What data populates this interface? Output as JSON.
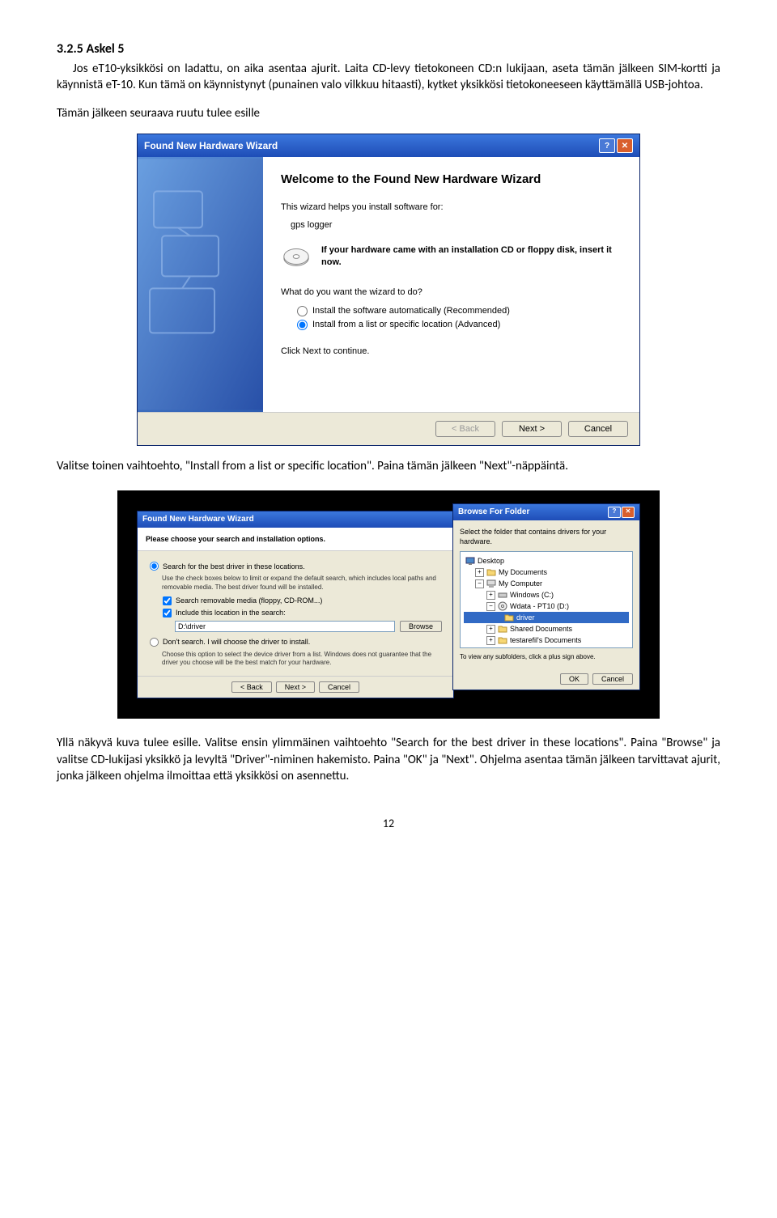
{
  "heading": "3.2.5 Askel 5",
  "para1": "Jos eT10-yksikkösi on ladattu, on aika asentaa ajurit. Laita CD-levy tietokoneen CD:n lukijaan, aseta tämän jälkeen SIM-kortti ja käynnistä eT-10. Kun tämä on käynnistynyt (punainen valo vilkkuu hitaasti), kytket yksikkösi tietokoneeseen käyttämällä USB-johtoa.",
  "para2": "Tämän jälkeen seuraava ruutu tulee esille",
  "wizard1": {
    "title": "Found New Hardware Wizard",
    "welcome": "Welcome to the Found New Hardware Wizard",
    "helps": "This wizard helps you install software for:",
    "device": "gps logger",
    "cd_hint": "If your hardware came with an installation CD or floppy disk, insert it now.",
    "question": "What do you want the wizard to do?",
    "opt1": "Install the software automatically (Recommended)",
    "opt2": "Install from a list or specific location (Advanced)",
    "click_next": "Click Next to continue.",
    "back": "< Back",
    "next": "Next >",
    "cancel": "Cancel"
  },
  "para3": "Valitse toinen vaihtoehto, \"Install from a list or specific location\". Paina tämän jälkeen \"Next\"-näppäintä.",
  "wizard2": {
    "title": "Found New Hardware Wizard",
    "header": "Please choose your search and installation options.",
    "opt_search": "Search for the best driver in these locations.",
    "hint": "Use the check boxes below to limit or expand the default search, which includes local paths and removable media. The best driver found will be installed.",
    "chk1": "Search removable media (floppy, CD-ROM...)",
    "chk2": "Include this location in the search:",
    "path": "D:\\driver",
    "browse": "Browse",
    "opt_dont": "Don't search. I will choose the driver to install.",
    "hint2": "Choose this option to select the device driver from a list. Windows does not guarantee that the driver you choose will be the best match for your hardware.",
    "back": "< Back",
    "next": "Next >",
    "cancel": "Cancel"
  },
  "browse": {
    "title": "Browse For Folder",
    "prompt": "Select the folder that contains drivers for your hardware.",
    "items": {
      "desktop": "Desktop",
      "mydocs": "My Documents",
      "mycomp": "My Computer",
      "winc": "Windows (C:)",
      "wdata": "Wdata - PT10 (D:)",
      "driver": "driver",
      "shared": "Shared Documents",
      "testar": "testarefil's Documents"
    },
    "sub_hint": "To view any subfolders, click a plus sign above.",
    "ok": "OK",
    "cancel": "Cancel"
  },
  "para4": "Yllä näkyvä kuva tulee esille. Valitse ensin ylimmäinen vaihtoehto \"Search for the best driver in these locations\". Paina \"Browse\" ja valitse CD-lukijasi yksikkö ja levyltä \"Driver\"-niminen hakemisto. Paina \"OK\" ja \"Next\". Ohjelma asentaa tämän jälkeen tarvittavat ajurit, jonka jälkeen ohjelma ilmoittaa että yksikkösi on asennettu.",
  "page_number": "12"
}
